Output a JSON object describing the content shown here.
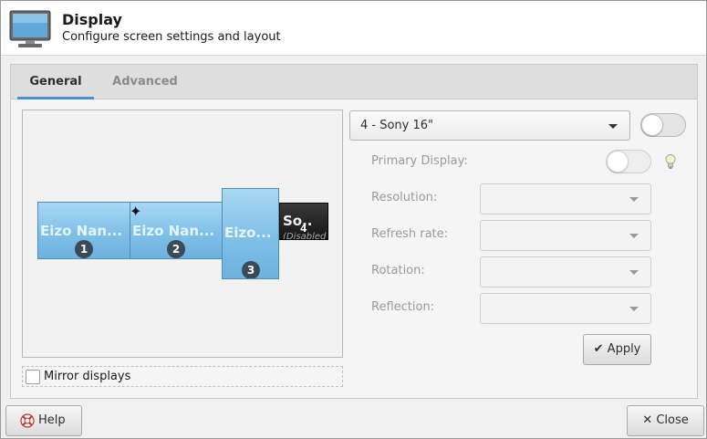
{
  "header": {
    "title": "Display",
    "subtitle": "Configure screen settings and layout",
    "icon": "monitor-icon"
  },
  "tabs": [
    {
      "label": "General",
      "active": true
    },
    {
      "label": "Advanced",
      "active": false
    }
  ],
  "monitors": [
    {
      "label": "Eizo Nan...",
      "number": "1"
    },
    {
      "label": "Eizo Nan...",
      "number": "2"
    },
    {
      "label": "Eizo...",
      "number": "3"
    },
    {
      "label": "So..",
      "number": "4",
      "sub": "(Disabled"
    }
  ],
  "primary_marker": "✦",
  "mirror": {
    "label": "Mirror displays",
    "checked": false
  },
  "output": {
    "selected": "4 - Sony 16\"",
    "enabled": false
  },
  "fields": {
    "primary_display": "Primary Display:",
    "resolution": "Resolution:",
    "refresh_rate": "Refresh rate:",
    "rotation": "Rotation:",
    "reflection": "Reflection:"
  },
  "apply_label": "Apply",
  "help_label": "Help",
  "close_label": "Close",
  "close_icon": "✕",
  "apply_icon": "✔",
  "colors": {
    "accent": "#4a90d9",
    "monitor_blue": "#7fc0e8",
    "disabled_text": "#9a9a9a"
  }
}
